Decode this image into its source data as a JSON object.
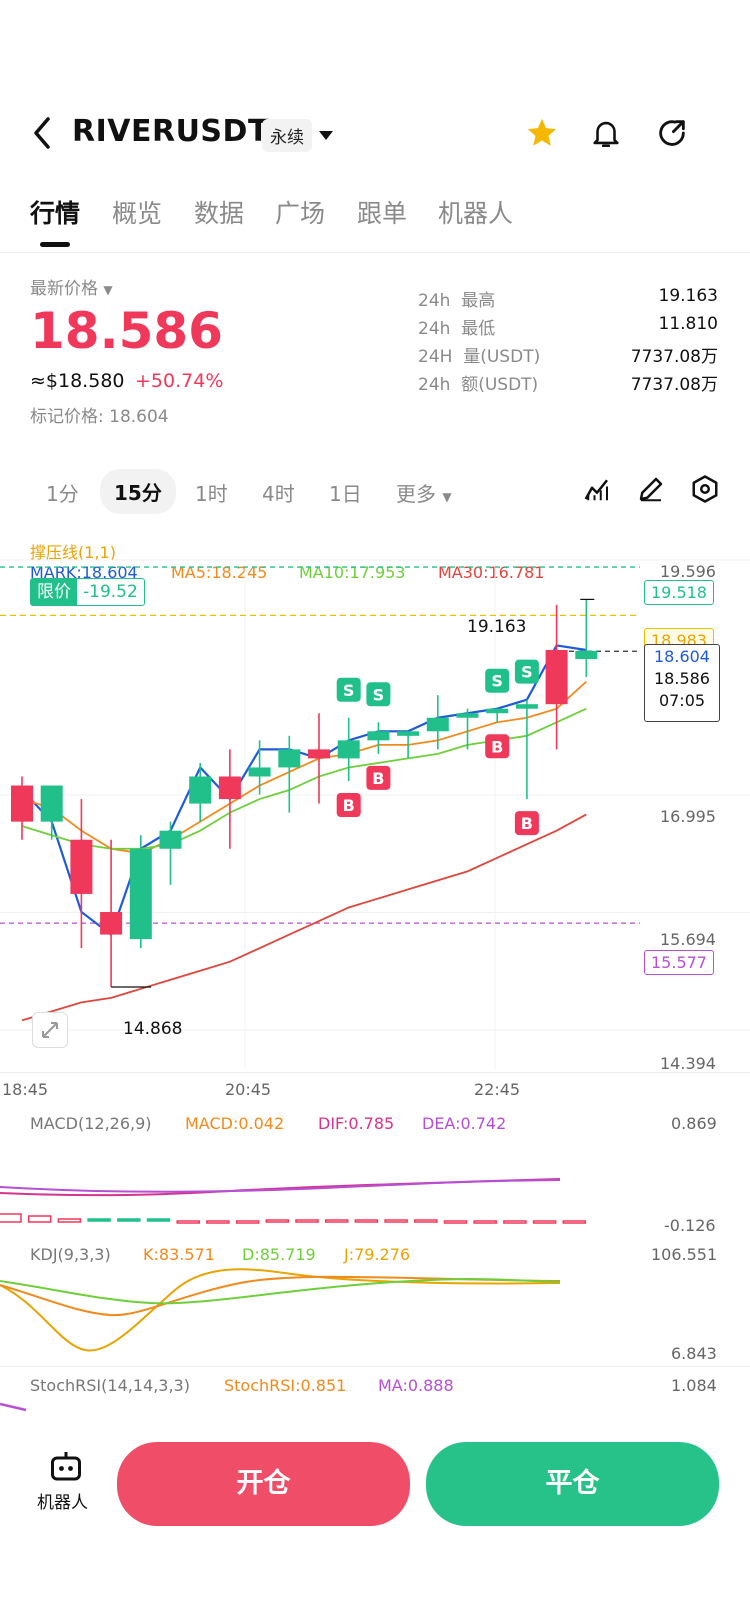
{
  "header": {
    "symbol": "RIVERUSDT",
    "contract_type": "永续"
  },
  "tabs": [
    {
      "label": "行情",
      "active": true
    },
    {
      "label": "概览"
    },
    {
      "label": "数据"
    },
    {
      "label": "广场"
    },
    {
      "label": "跟单"
    },
    {
      "label": "机器人"
    }
  ],
  "price": {
    "label": "最新价格",
    "last": "18.586",
    "usd": "≈$18.580",
    "change": "+50.74%",
    "mark": "标记价格: 18.604",
    "color_up": "#f0385b",
    "color_down": "#21c08b"
  },
  "stats": [
    {
      "period": "24h",
      "name": "最高",
      "value": "19.163"
    },
    {
      "period": "24h",
      "name": "最低",
      "value": "11.810"
    },
    {
      "period": "24H",
      "name": "量(USDT)",
      "value": "7737.08万"
    },
    {
      "period": "24h",
      "name": "额(USDT)",
      "value": "7737.08万"
    }
  ],
  "timeframes": [
    {
      "label": "1分"
    },
    {
      "label": "15分",
      "active": true
    },
    {
      "label": "1时"
    },
    {
      "label": "4时"
    },
    {
      "label": "1日"
    },
    {
      "label": "更多"
    }
  ],
  "indicators": {
    "support": "撑压线(1,1)",
    "mark": "MARK:18.604",
    "ma5": "MA5:18.245",
    "ma10": "MA10:17.953",
    "ma30": "MA30:16.781",
    "limit_label": "限价",
    "limit_value": "-19.52",
    "macd_title": "MACD(12,26,9)",
    "macd": "MACD:0.042",
    "dif": "DIF:0.785",
    "dea": "DEA:0.742",
    "kdj_title": "KDJ(9,3,3)",
    "k": "K:83.571",
    "d": "D:85.719",
    "j": "J:79.276",
    "stoch_title": "StochRSI(14,14,3,3)",
    "stoch": "StochRSI:0.851",
    "stoch_ma": "MA:0.888"
  },
  "tags": {
    "limit": "19.518",
    "support_line": "18.983",
    "mark": "18.604",
    "last": "18.586",
    "countdown": "07:05",
    "ma_marker": "15.577",
    "high": "19.163",
    "low": "14.868"
  },
  "axes": {
    "price_ticks": [
      "19.596",
      "16.995",
      "15.694",
      "14.394"
    ],
    "time_ticks": [
      "18:45",
      "20:45",
      "22:45"
    ],
    "macd_ticks": [
      "0.869",
      "-0.126"
    ],
    "kdj_ticks": [
      "106.551",
      "6.843"
    ],
    "stoch_ticks": [
      "1.084"
    ]
  },
  "chart_data": {
    "type": "candlestick",
    "y_range": [
      14.394,
      19.596
    ],
    "x_labels": [
      "18:45",
      "20:45",
      "22:45"
    ],
    "candles": [
      {
        "o": 17.1,
        "h": 17.2,
        "l": 16.5,
        "c": 16.7
      },
      {
        "o": 16.7,
        "h": 17.05,
        "l": 16.5,
        "c": 17.1
      },
      {
        "o": 16.5,
        "h": 16.95,
        "l": 15.3,
        "c": 15.9
      },
      {
        "o": 15.7,
        "h": 16.5,
        "l": 14.87,
        "c": 15.45
      },
      {
        "o": 15.4,
        "h": 16.55,
        "l": 15.3,
        "c": 16.4
      },
      {
        "o": 16.4,
        "h": 16.7,
        "l": 16.0,
        "c": 16.6
      },
      {
        "o": 16.9,
        "h": 17.35,
        "l": 16.7,
        "c": 17.2
      },
      {
        "o": 17.2,
        "h": 17.5,
        "l": 16.4,
        "c": 16.95
      },
      {
        "o": 17.2,
        "h": 17.6,
        "l": 17.0,
        "c": 17.3
      },
      {
        "o": 17.3,
        "h": 17.65,
        "l": 16.8,
        "c": 17.5
      },
      {
        "o": 17.5,
        "h": 17.9,
        "l": 16.9,
        "c": 17.4
      },
      {
        "o": 17.4,
        "h": 17.85,
        "l": 17.15,
        "c": 17.6
      },
      {
        "o": 17.6,
        "h": 17.8,
        "l": 17.45,
        "c": 17.7
      },
      {
        "o": 17.65,
        "h": 17.7,
        "l": 17.4,
        "c": 17.7
      },
      {
        "o": 17.7,
        "h": 18.1,
        "l": 17.5,
        "c": 17.85
      },
      {
        "o": 17.85,
        "h": 17.95,
        "l": 17.5,
        "c": 17.9
      },
      {
        "o": 17.9,
        "h": 17.95,
        "l": 17.8,
        "c": 17.95
      },
      {
        "o": 17.95,
        "h": 18.05,
        "l": 16.95,
        "c": 18.0
      },
      {
        "o": 18.6,
        "h": 19.1,
        "l": 17.5,
        "c": 18.0
      },
      {
        "o": 18.5,
        "h": 19.16,
        "l": 18.3,
        "c": 18.59
      }
    ],
    "series": [
      {
        "name": "MARK",
        "values": [
          17.05,
          16.7,
          15.7,
          15.45,
          16.4,
          16.6,
          17.3,
          16.95,
          17.5,
          17.5,
          17.4,
          17.6,
          17.7,
          17.7,
          17.85,
          17.9,
          17.95,
          18.05,
          18.65,
          18.6
        ]
      },
      {
        "name": "MA5",
        "values": [
          16.95,
          16.85,
          16.6,
          16.4,
          16.35,
          16.5,
          16.7,
          16.9,
          17.1,
          17.25,
          17.4,
          17.45,
          17.55,
          17.55,
          17.6,
          17.7,
          17.8,
          17.85,
          17.95,
          18.25
        ]
      },
      {
        "name": "MA10",
        "values": [
          16.65,
          16.55,
          16.45,
          16.4,
          16.4,
          16.45,
          16.6,
          16.8,
          16.95,
          17.05,
          17.2,
          17.3,
          17.35,
          17.4,
          17.45,
          17.55,
          17.6,
          17.65,
          17.8,
          17.95
        ]
      },
      {
        "name": "MA30",
        "values": [
          14.5,
          14.6,
          14.7,
          14.75,
          14.85,
          14.95,
          15.05,
          15.15,
          15.3,
          15.45,
          15.6,
          15.75,
          15.85,
          15.95,
          16.05,
          16.15,
          16.3,
          16.45,
          16.6,
          16.78
        ]
      }
    ],
    "signals": [
      {
        "index": 11,
        "type": "S"
      },
      {
        "index": 12,
        "type": "S"
      },
      {
        "index": 11,
        "type": "B"
      },
      {
        "index": 12,
        "type": "B"
      },
      {
        "index": 16,
        "type": "S"
      },
      {
        "index": 16,
        "type": "B"
      },
      {
        "index": 17,
        "type": "S"
      },
      {
        "index": 17,
        "type": "B"
      }
    ]
  },
  "bottom": {
    "robot_label": "机器人",
    "open": "开仓",
    "close": "平仓"
  }
}
